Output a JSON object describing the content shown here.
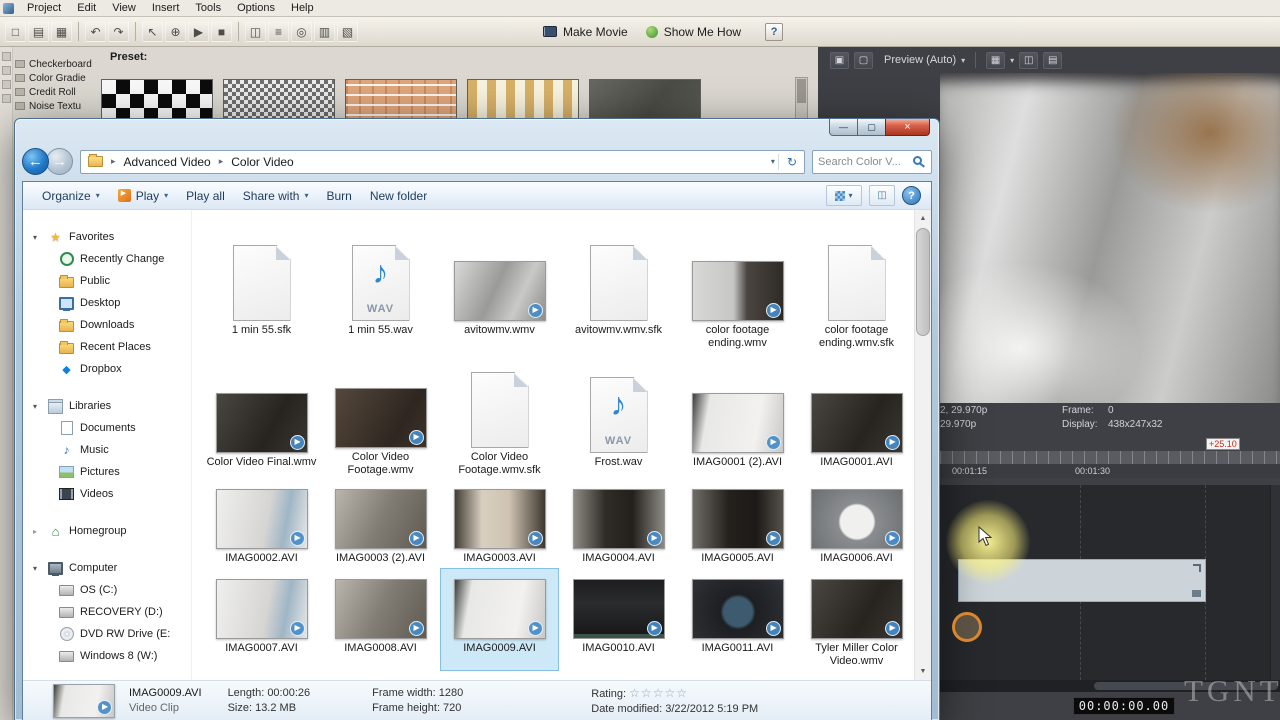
{
  "editor": {
    "menubar": [
      "Project",
      "Edit",
      "View",
      "Insert",
      "Tools",
      "Options",
      "Help"
    ],
    "toolbar": {
      "icons": [
        "□",
        "▤",
        "▦",
        "↶",
        "↷",
        "↖",
        "⊕",
        "▶",
        "■",
        "◫",
        "≡",
        "◎",
        "▥",
        "▧"
      ],
      "make_movie": "Make Movie",
      "show_me_how": "Show Me How",
      "help_glyph": "?"
    },
    "presets": {
      "label": "Preset:",
      "list": [
        "Checkerboard",
        "Color Gradie",
        "Credit Roll",
        "Noise Textu"
      ]
    },
    "preview": {
      "label": "Preview (Auto)",
      "icons": [
        "▣",
        "▢",
        "▦",
        "◫",
        "▤"
      ]
    },
    "clip_info": {
      "left_line1": "2, 29.970p",
      "left_line2": "29.970p",
      "frame_label": "Frame:",
      "frame_value": "0",
      "display_label": "Display:",
      "display_value": "438x247x32",
      "badge": "+25.10"
    },
    "timeline": {
      "tick1": "00:01:15",
      "tick2": "00:01:30",
      "timecode": "00:00:00.00"
    },
    "watermark": "TGNT"
  },
  "explorer": {
    "titlebar": {
      "minimize": "—",
      "maximize": "▢",
      "close": "×"
    },
    "address": {
      "crumb1": "Advanced Video",
      "crumb2": "Color Video",
      "search_placeholder": "Search Color V..."
    },
    "commandbar": {
      "organize": "Organize",
      "play": "Play",
      "play_all": "Play all",
      "share_with": "Share with",
      "burn": "Burn",
      "new_folder": "New folder",
      "help": "?"
    },
    "sidebar": {
      "favorites": "Favorites",
      "fav_items": [
        "Recently Change",
        "Public",
        "Desktop",
        "Downloads",
        "Recent Places",
        "Dropbox"
      ],
      "libraries": "Libraries",
      "lib_items": [
        "Documents",
        "Music",
        "Pictures",
        "Videos"
      ],
      "homegroup": "Homegroup",
      "computer": "Computer",
      "comp_items": [
        "OS (C:)",
        "RECOVERY (D:)",
        "DVD RW Drive (E:",
        "Windows 8 (W:)"
      ]
    },
    "wav_badge": "WAV",
    "files": [
      {
        "name": "1 min 55.sfk",
        "type": "sfk"
      },
      {
        "name": "1 min 55.wav",
        "type": "wav"
      },
      {
        "name": "avitowmv.wmv",
        "type": "video"
      },
      {
        "name": "avitowmv.wmv.sfk",
        "type": "sfk"
      },
      {
        "name": "color footage ending.wmv",
        "type": "video"
      },
      {
        "name": "color footage ending.wmv.sfk",
        "type": "sfk"
      },
      {
        "name": "Color Video Final.wmv",
        "type": "video"
      },
      {
        "name": "Color Video Footage.wmv",
        "type": "video"
      },
      {
        "name": "Color Video Footage.wmv.sfk",
        "type": "sfk"
      },
      {
        "name": "Frost.wav",
        "type": "wav"
      },
      {
        "name": "IMAG0001 (2).AVI",
        "type": "video"
      },
      {
        "name": "IMAG0001.AVI",
        "type": "video"
      },
      {
        "name": "IMAG0002.AVI",
        "type": "video"
      },
      {
        "name": "IMAG0003 (2).AVI",
        "type": "video"
      },
      {
        "name": "IMAG0003.AVI",
        "type": "video"
      },
      {
        "name": "IMAG0004.AVI",
        "type": "video"
      },
      {
        "name": "IMAG0005.AVI",
        "type": "video"
      },
      {
        "name": "IMAG0006.AVI",
        "type": "video"
      },
      {
        "name": "IMAG0007.AVI",
        "type": "video"
      },
      {
        "name": "IMAG0008.AVI",
        "type": "video"
      },
      {
        "name": "IMAG0009.AVI",
        "type": "video",
        "selected": true
      },
      {
        "name": "IMAG0010.AVI",
        "type": "video"
      },
      {
        "name": "IMAG0011.AVI",
        "type": "video"
      },
      {
        "name": "Tyler Miller Color Video.wmv",
        "type": "video"
      }
    ],
    "details": {
      "name": "IMAG0009.AVI",
      "kind": "Video Clip",
      "length": "Length: 00:00:26",
      "size": "Size: 13.2 MB",
      "frame_width": "Frame width: 1280",
      "frame_height": "Frame height: 720",
      "rating_label": "Rating:",
      "stars": "☆☆☆☆☆",
      "date_modified": "Date modified: 3/22/2012 5:19 PM"
    }
  }
}
